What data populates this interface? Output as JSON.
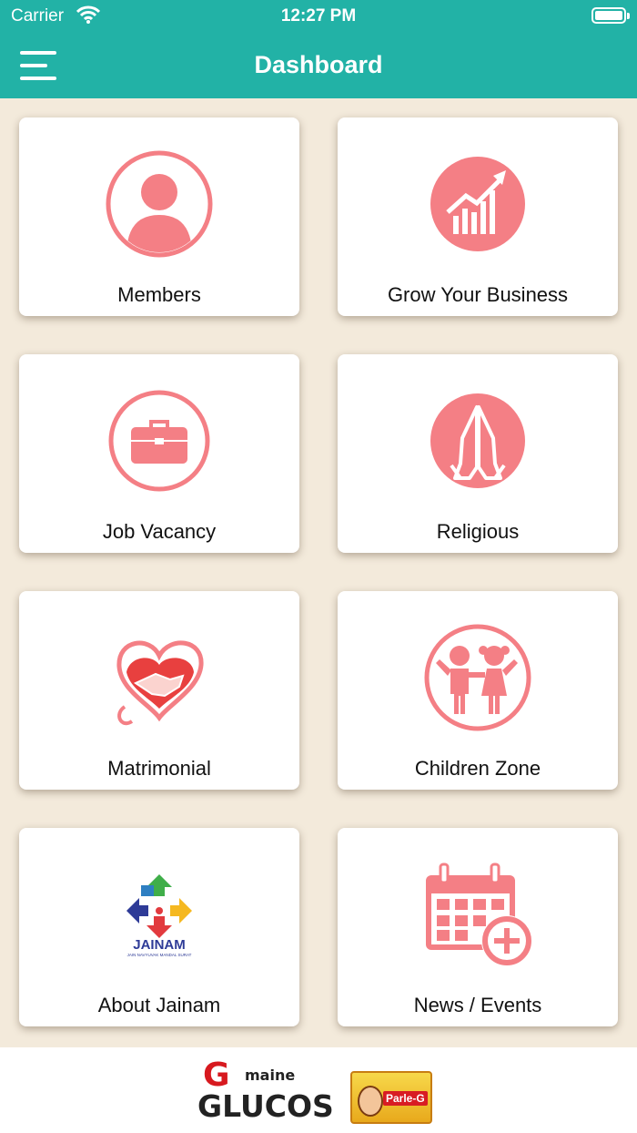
{
  "status_bar": {
    "carrier": "Carrier",
    "time": "12:27 PM"
  },
  "header": {
    "title": "Dashboard",
    "menu_icon": "hamburger-menu-icon"
  },
  "accent_color": "#22b2a6",
  "icon_color": "#f47f85",
  "tiles": [
    {
      "label": "Members",
      "icon": "user-icon"
    },
    {
      "label": "Grow Your Business",
      "icon": "growth-chart-icon"
    },
    {
      "label": "Job Vacancy",
      "icon": "briefcase-icon"
    },
    {
      "label": "Religious",
      "icon": "praying-hands-icon"
    },
    {
      "label": "Matrimonial",
      "icon": "heart-handshake-icon"
    },
    {
      "label": "Children Zone",
      "icon": "children-icon"
    },
    {
      "label": "About Jainam",
      "icon": "jainam-logo-icon",
      "logo_text": "JAINAM",
      "logo_subtext": "JAIN NAVYUVAK MANDAL SURAT"
    },
    {
      "label": "News / Events",
      "icon": "calendar-add-icon"
    }
  ],
  "ad_banner": {
    "left_ad_text": "G maine GLUCOSE",
    "right_ad_text": "Parle-G"
  }
}
